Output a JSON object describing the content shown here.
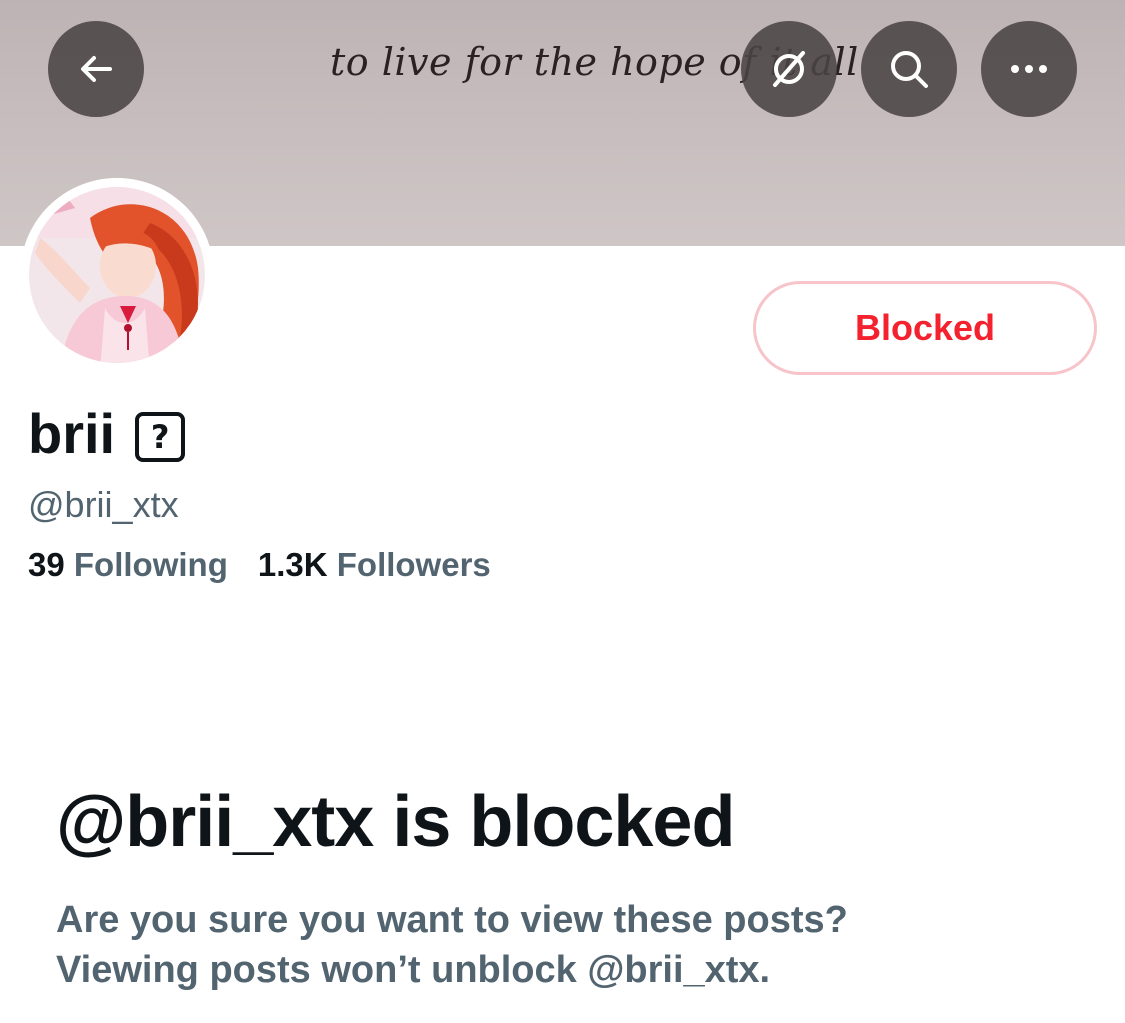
{
  "banner": {
    "text": "to live for the hope of it all"
  },
  "top_actions": {
    "back_icon": "arrow-left-icon",
    "grok_icon": "grok-icon",
    "search_icon": "search-icon",
    "more_icon": "more-horizontal-icon"
  },
  "profile": {
    "display_name": "brii",
    "unknown_glyph": "?",
    "handle": "@brii_xtx",
    "following_count": "39",
    "following_label": "Following",
    "followers_count": "1.3K",
    "followers_label": "Followers"
  },
  "blocked_button": {
    "label": "Blocked"
  },
  "blocked_notice": {
    "title": "@brii_xtx is blocked",
    "line1": "Are you sure you want to view these posts?",
    "line2": "Viewing posts won’t unblock @brii_xtx."
  },
  "colors": {
    "text_primary": "#0f1419",
    "text_secondary": "#536471",
    "blocked_red": "#f4212e",
    "blocked_border": "#f7c4c9"
  }
}
